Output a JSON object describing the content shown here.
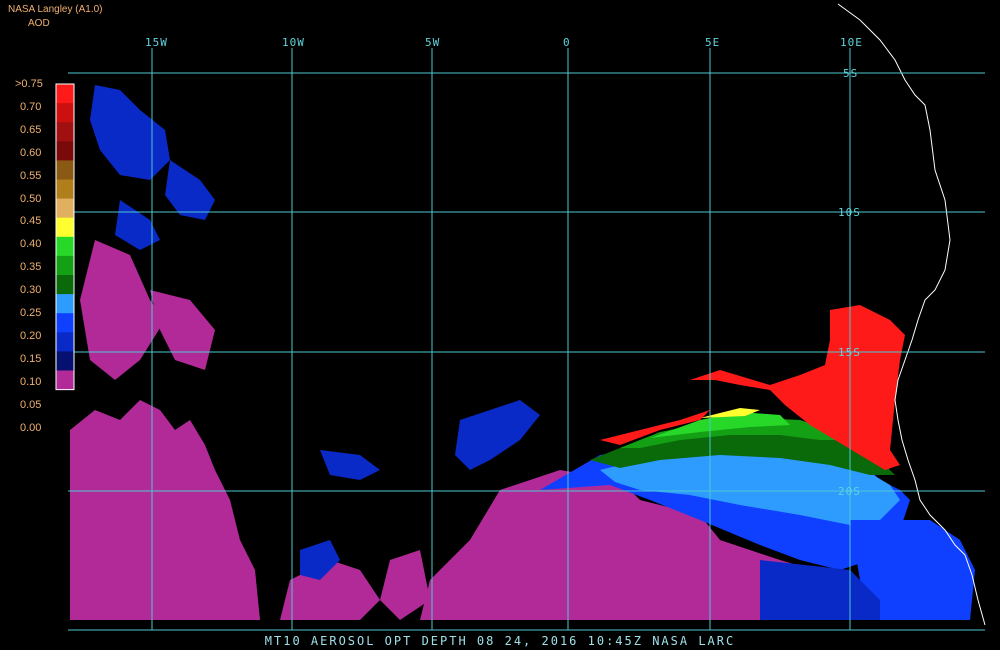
{
  "header": {
    "title": "NASA Langley (A1.0)",
    "subtitle": "AOD"
  },
  "legend": {
    "labels": [
      ">0.75",
      "0.70",
      "0.65",
      "0.60",
      "0.55",
      "0.50",
      "0.45",
      "0.40",
      "0.35",
      "0.30",
      "0.25",
      "0.20",
      "0.15",
      "0.10",
      "0.05",
      "0.00"
    ],
    "colors": [
      "#ff1a1a",
      "#cc1010",
      "#a01010",
      "#7a0a0a",
      "#8a5a14",
      "#b07f1c",
      "#e0b060",
      "#ffff30",
      "#28d828",
      "#14a014",
      "#0a6a0a",
      "#2e9cff",
      "#1040ff",
      "#0a2ac8",
      "#061070",
      "#b22a98"
    ]
  },
  "longitudes": [
    "15W",
    "10W",
    "5W",
    "0",
    "5E",
    "10E"
  ],
  "latitudes": [
    "5S",
    "10S",
    "15S",
    "20S"
  ],
  "footer": "MT10  AEROSOL OPT DEPTH   08 24, 2016 10:45Z   NASA LARC"
}
